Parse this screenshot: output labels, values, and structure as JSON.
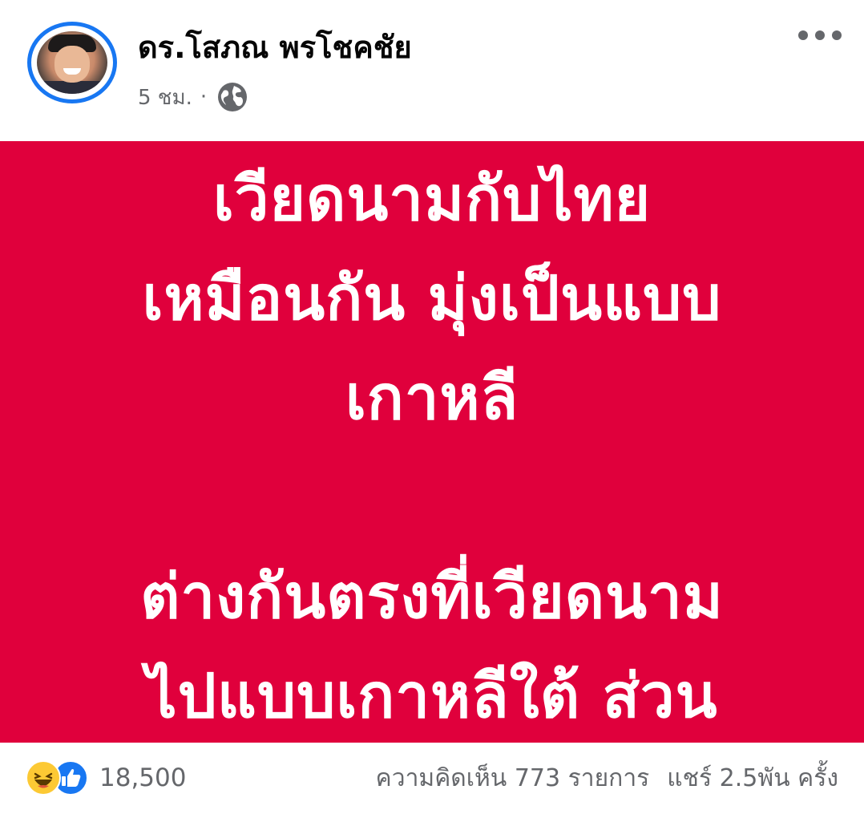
{
  "post": {
    "author_name": "ดร.โสภณ พรโชคชัย",
    "timestamp": "5 ชม.",
    "separator": "·",
    "privacy_icon": "globe-icon",
    "more_icon": "more-options-icon"
  },
  "image_card": {
    "background_color": "#e0003c",
    "text_color": "#ffffff",
    "text": "เวียดนามกับไทย\nเหมือนกัน มุ่งเป็นแบบ\nเกาหลี\n\nต่างกันตรงที่เวียดนาม\nไปแบบเกาหลีใต้ ส่วน"
  },
  "footer": {
    "reaction_icons": [
      "haha-reaction-icon",
      "like-reaction-icon"
    ],
    "reaction_count": "18,500",
    "comments": "ความคิดเห็น 773 รายการ",
    "shares": "แชร์ 2.5พัน ครั้ง"
  }
}
